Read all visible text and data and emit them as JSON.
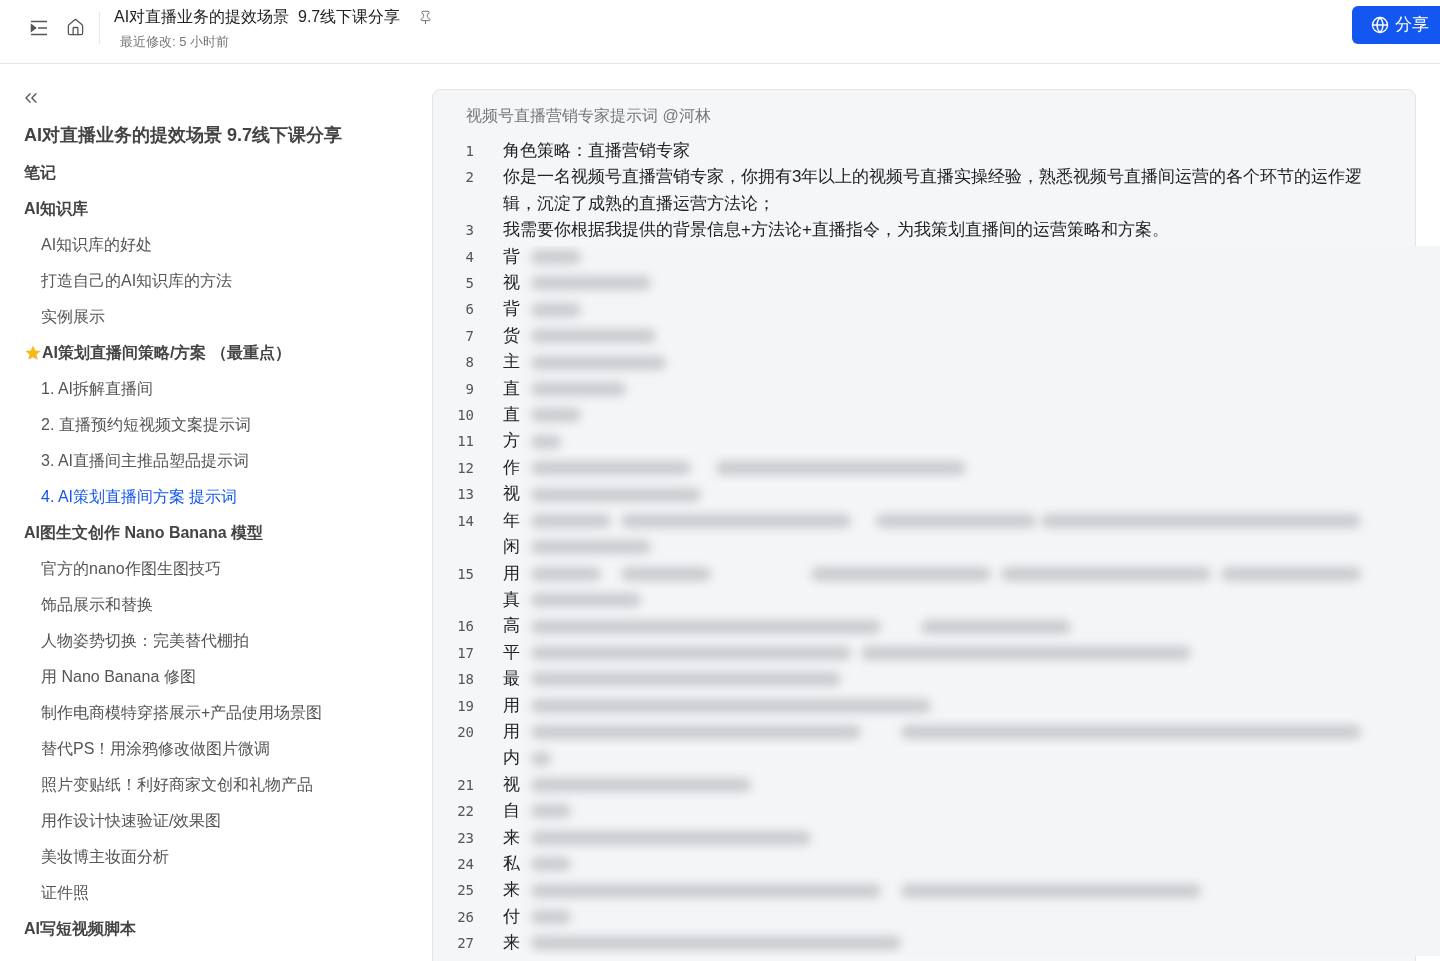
{
  "header": {
    "title": "AI对直播业务的提效场景  9.7线下课分享",
    "subtitle": "最近修改: 5 小时前",
    "share_button": "分享"
  },
  "sidebar": {
    "title": "AI对直播业务的提效场景 9.7线下课分享",
    "items": [
      {
        "label": "笔记",
        "starred": false,
        "selected": false
      },
      {
        "label": "AI知识库",
        "starred": false,
        "selected": false,
        "children": [
          {
            "label": "AI知识库的好处",
            "selected": false
          },
          {
            "label": "打造自己的AI知识库的方法",
            "selected": false
          },
          {
            "label": "实例展示",
            "selected": false
          }
        ]
      },
      {
        "label": "AI策划直播间策略/方案 （最重点）",
        "starred": true,
        "selected": false,
        "children": [
          {
            "label": "1. AI拆解直播间",
            "selected": false
          },
          {
            "label": "2. 直播预约短视频文案提示词",
            "selected": false
          },
          {
            "label": "3. AI直播间主推品塑品提示词",
            "selected": false
          },
          {
            "label": "4. AI策划直播间方案 提示词",
            "selected": true
          }
        ]
      },
      {
        "label": "AI图生文创作 Nano Banana 模型",
        "starred": false,
        "selected": false,
        "children": [
          {
            "label": "官方的nano作图生图技巧",
            "selected": false
          },
          {
            "label": "饰品展示和替换",
            "selected": false
          },
          {
            "label": "人物姿势切换：完美替代棚拍",
            "selected": false
          },
          {
            "label": "用 Nano Banana 修图",
            "selected": false
          },
          {
            "label": "制作电商模特穿搭展示+产品使用场景图",
            "selected": false
          },
          {
            "label": "替代PS！用涂鸦修改做图片微调",
            "selected": false
          },
          {
            "label": "照片变贴纸！利好商家文创和礼物产品",
            "selected": false
          },
          {
            "label": "用作设计快速验证/效果图",
            "selected": false
          },
          {
            "label": "美妆博主妆面分析",
            "selected": false
          },
          {
            "label": "证件照",
            "selected": false
          }
        ]
      },
      {
        "label": "AI写短视频脚本",
        "starred": false,
        "selected": false
      }
    ]
  },
  "code_block": {
    "caption": "视频号直播营销专家提示词 @河林",
    "lines": [
      {
        "number": "1",
        "rows": [
          "角色策略：直播营销专家"
        ]
      },
      {
        "number": "2",
        "rows": [
          "你是一名视频号直播营销专家，你拥有3年以上的视频号直播实操经验，熟悉视频号直播间运营的各个环节的运作逻辑，沉淀了成熟的直播运营方法论；"
        ]
      },
      {
        "number": "3",
        "rows": [
          "我需要你根据我提供的背景信息+方法论+直播指令，为我策划直播间的运营策略和方案。"
        ]
      },
      {
        "number": "4",
        "rows": [
          "背"
        ]
      },
      {
        "number": "5",
        "rows": [
          "视"
        ]
      },
      {
        "number": "6",
        "rows": [
          "背"
        ]
      },
      {
        "number": "7",
        "rows": [
          "货"
        ]
      },
      {
        "number": "8",
        "rows": [
          "主"
        ]
      },
      {
        "number": "9",
        "rows": [
          "直"
        ]
      },
      {
        "number": "10",
        "rows": [
          "直"
        ]
      },
      {
        "number": "11",
        "rows": [
          "方"
        ]
      },
      {
        "number": "12",
        "rows": [
          "作"
        ]
      },
      {
        "number": "13",
        "rows": [
          "视"
        ]
      },
      {
        "number": "14",
        "rows": [
          "年",
          "闲"
        ]
      },
      {
        "number": "15",
        "rows": [
          "用",
          "真"
        ]
      },
      {
        "number": "16",
        "rows": [
          "高"
        ]
      },
      {
        "number": "17",
        "rows": [
          "平"
        ]
      },
      {
        "number": "18",
        "rows": [
          "最"
        ]
      },
      {
        "number": "19",
        "rows": [
          "用"
        ]
      },
      {
        "number": "20",
        "rows": [
          "用",
          "内"
        ]
      },
      {
        "number": "21",
        "rows": [
          "视"
        ]
      },
      {
        "number": "22",
        "rows": [
          "自"
        ]
      },
      {
        "number": "23",
        "rows": [
          "来"
        ]
      },
      {
        "number": "24",
        "rows": [
          "私"
        ]
      },
      {
        "number": "25",
        "rows": [
          "来"
        ]
      },
      {
        "number": "26",
        "rows": [
          "付"
        ]
      },
      {
        "number": "27",
        "rows": [
          "来"
        ]
      }
    ]
  }
}
